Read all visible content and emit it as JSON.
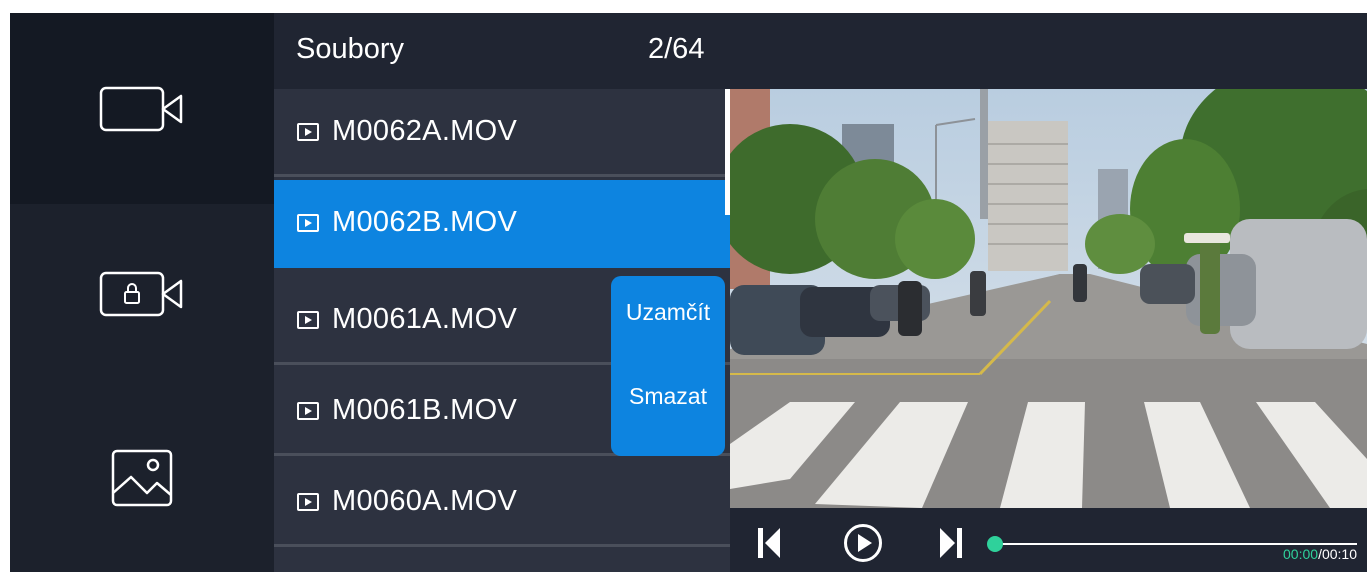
{
  "sidebar": {
    "items": [
      {
        "icon": "video-camera-icon",
        "active": true
      },
      {
        "icon": "locked-video-icon",
        "active": false
      },
      {
        "icon": "image-gallery-icon",
        "active": false
      }
    ]
  },
  "header": {
    "title": "Soubory",
    "count": "2/64"
  },
  "files": [
    {
      "name": "M0062A.MOV",
      "selected": false
    },
    {
      "name": "M0062B.MOV",
      "selected": true
    },
    {
      "name": "M0061A.MOV",
      "selected": false
    },
    {
      "name": "M0061B.MOV",
      "selected": false
    },
    {
      "name": "M0060A.MOV",
      "selected": false
    }
  ],
  "action_menu": {
    "lock_label": "Uzamčít",
    "delete_label": "Smazat"
  },
  "player": {
    "current_time": "00:00",
    "separator": "/",
    "duration": "00:10",
    "progress": 0.0
  },
  "colors": {
    "accent": "#0d84e0",
    "progress": "#2fd19b",
    "background": "#202532"
  }
}
